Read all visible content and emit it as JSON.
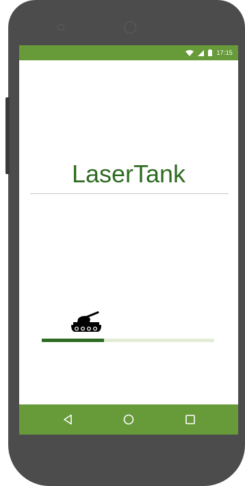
{
  "status_bar": {
    "time": "17:15",
    "icons": [
      "wifi-icon",
      "cell-signal-icon",
      "battery-icon"
    ]
  },
  "app": {
    "title": "LaserTank"
  },
  "loading": {
    "icon": "tank-icon",
    "progress": 0.36
  },
  "nav_bar": {
    "buttons": [
      "back-button",
      "home-button",
      "recents-button"
    ]
  },
  "colors": {
    "accent": "#679a39",
    "title": "#2e6b22",
    "progress_fill": "#2e6b22",
    "progress_track": "#e2ecd4",
    "device": "#4c4c4c"
  }
}
